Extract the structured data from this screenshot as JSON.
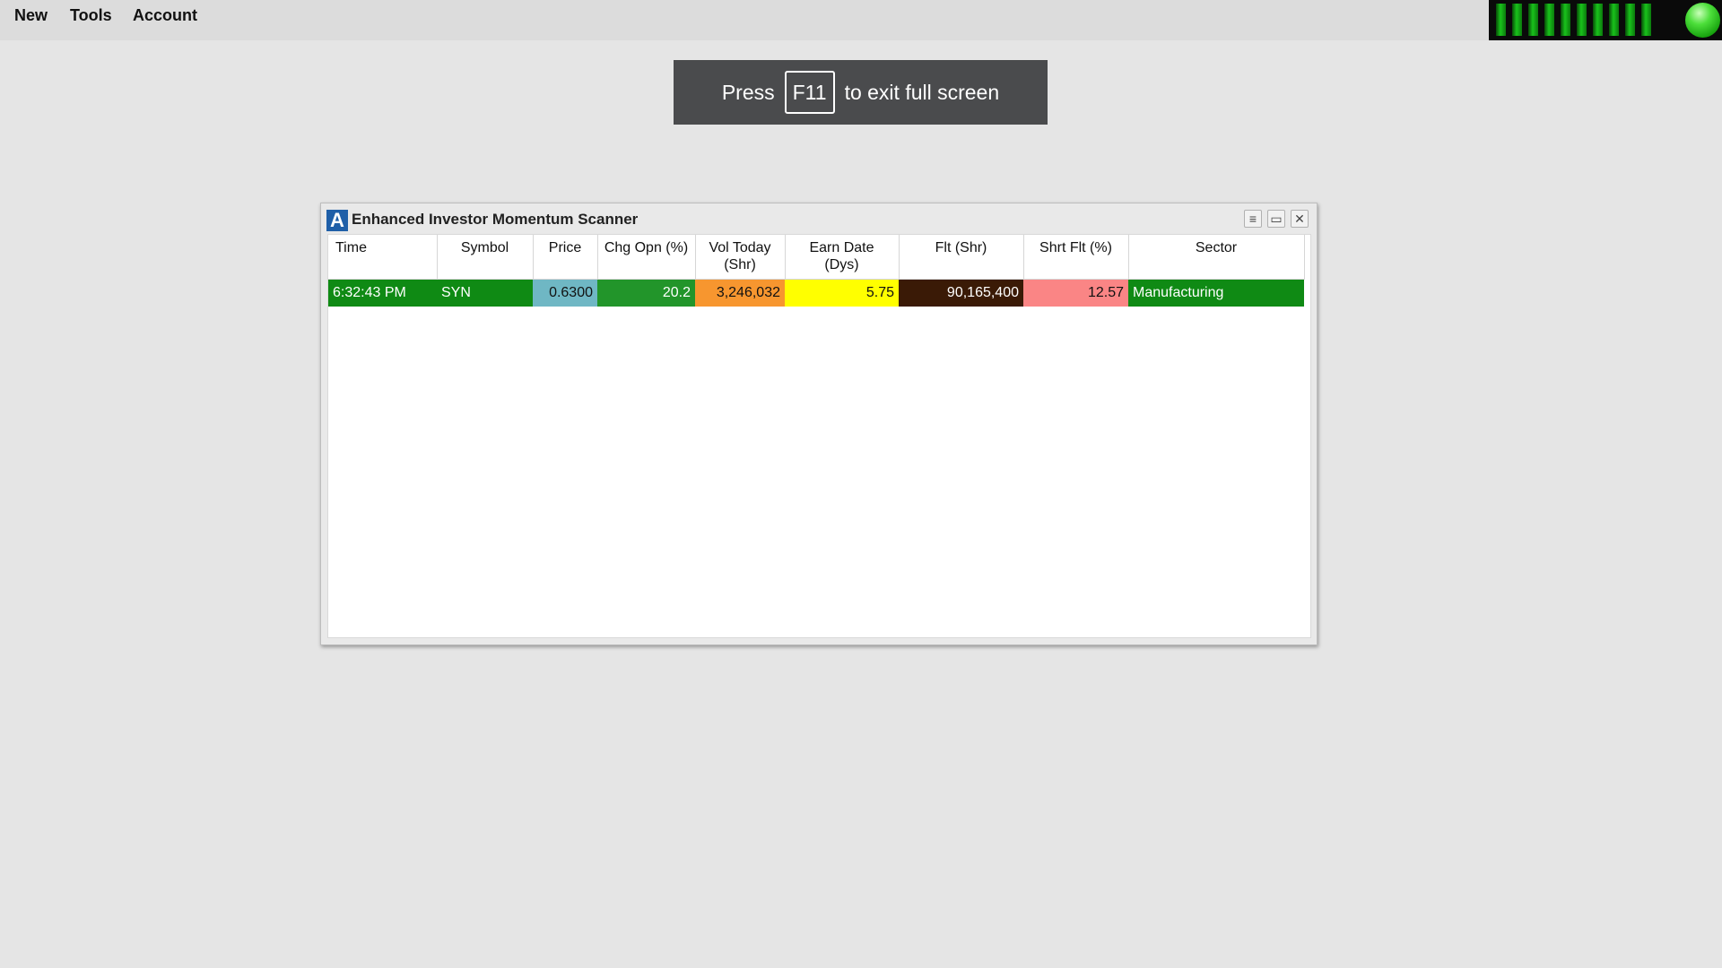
{
  "menu": {
    "items": [
      {
        "label": "New"
      },
      {
        "label": "Tools"
      },
      {
        "label": "Account"
      }
    ]
  },
  "status": {
    "signal_bars": 10,
    "connection_icon": "green-status-dot",
    "connection_color": "#2fcf2a"
  },
  "fullscreen_notice": {
    "prefix": "Press",
    "key": "F11",
    "suffix": "to exit full screen"
  },
  "scanner": {
    "logo_letter": "A",
    "title": "Enhanced Investor Momentum Scanner",
    "buttons": {
      "menu_icon": "≡",
      "maximize_icon": "▭",
      "close_icon": "✕"
    },
    "columns": [
      {
        "label": "Time",
        "sub": ""
      },
      {
        "label": "Symbol",
        "sub": ""
      },
      {
        "label": "Price",
        "sub": ""
      },
      {
        "label": "Chg Opn (%)",
        "sub": ""
      },
      {
        "label": "Vol Today",
        "sub": "(Shr)"
      },
      {
        "label": "Earn Date",
        "sub": "(Dys)"
      },
      {
        "label": "Flt (Shr)",
        "sub": ""
      },
      {
        "label": "Shrt Flt (%)",
        "sub": ""
      },
      {
        "label": "Sector",
        "sub": ""
      }
    ],
    "rows": [
      {
        "time": "6:32:43 PM",
        "symbol": "SYN",
        "price": "0.6300",
        "chg_opn": "20.2",
        "vol_today": "3,246,032",
        "earn_date": "5.75",
        "float": "90,165,400",
        "short_float": "12.57",
        "sector": "Manufacturing"
      }
    ],
    "colors": {
      "time": "#0f8a14",
      "price": "#6fb7c4",
      "chg_opn": "#22952a",
      "vol_today": "#f7962f",
      "earn_date": "#ffff00",
      "float": "#3a1a06",
      "short_float": "#fa8585",
      "sector": "#0f8a14"
    }
  }
}
